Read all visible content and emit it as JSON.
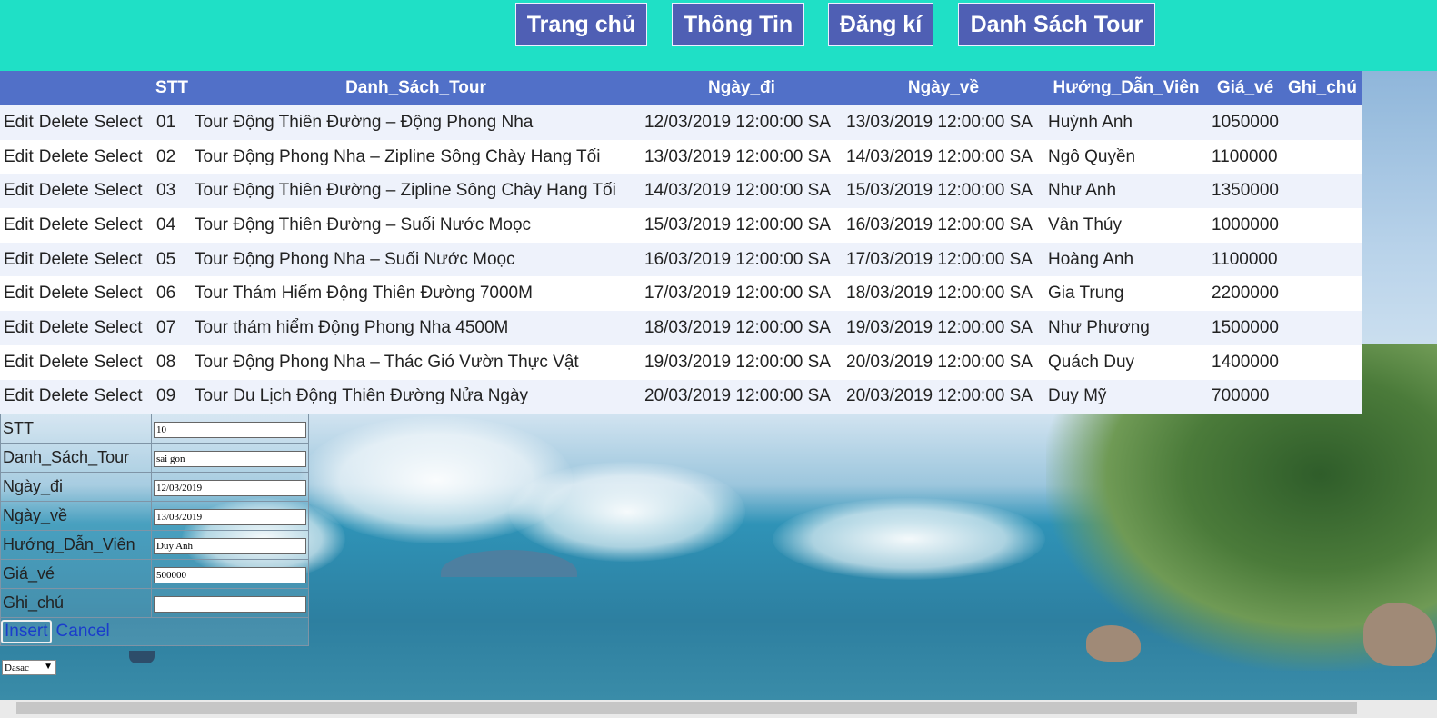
{
  "nav": [
    "Trang chủ",
    "Thông Tin",
    "Đăng kí",
    "Danh Sách Tour"
  ],
  "grid": {
    "headers": [
      "STT",
      "Danh_Sách_Tour",
      "Ngày_đi",
      "Ngày_về",
      "Hướng_Dẫn_Viên",
      "Giá_vé",
      "Ghi_chú"
    ],
    "commands": [
      "Edit",
      "Delete",
      "Select"
    ],
    "rows": [
      [
        "01",
        "Tour Động Thiên Đường – Động Phong Nha",
        "12/03/2019 12:00:00 SA",
        "13/03/2019 12:00:00 SA",
        "Huỳnh Anh",
        "1050000",
        ""
      ],
      [
        "02",
        "Tour Động Phong Nha – Zipline Sông Chày Hang Tối",
        "13/03/2019 12:00:00 SA",
        "14/03/2019 12:00:00 SA",
        "Ngô Quyền",
        "1100000",
        ""
      ],
      [
        "03",
        "Tour Động Thiên Đường – Zipline Sông Chày Hang Tối",
        "14/03/2019 12:00:00 SA",
        "15/03/2019 12:00:00 SA",
        "Như Anh",
        "1350000",
        ""
      ],
      [
        "04",
        "Tour Động Thiên Đường – Suối Nước Moọc",
        "15/03/2019 12:00:00 SA",
        "16/03/2019 12:00:00 SA",
        "Vân Thúy",
        "1000000",
        ""
      ],
      [
        "05",
        "Tour Động Phong Nha – Suối Nước Moọc",
        "16/03/2019 12:00:00 SA",
        "17/03/2019 12:00:00 SA",
        "Hoàng Anh",
        "1100000",
        ""
      ],
      [
        "06",
        "Tour Thám Hiểm Động Thiên Đường 7000M",
        "17/03/2019 12:00:00 SA",
        "18/03/2019 12:00:00 SA",
        "Gia Trung",
        "2200000",
        ""
      ],
      [
        "07",
        "Tour thám hiểm Động Phong Nha 4500M",
        "18/03/2019 12:00:00 SA",
        "19/03/2019 12:00:00 SA",
        "Như Phương",
        "1500000",
        ""
      ],
      [
        "08",
        "Tour Động Phong Nha – Thác Gió Vườn Thực Vật",
        "19/03/2019 12:00:00 SA",
        "20/03/2019 12:00:00 SA",
        "Quách Duy",
        "1400000",
        ""
      ],
      [
        "09",
        "Tour Du Lịch Động Thiên Đường Nửa Ngày",
        "20/03/2019 12:00:00 SA",
        "20/03/2019 12:00:00 SA",
        "Duy Mỹ",
        "700000",
        ""
      ]
    ]
  },
  "form": {
    "fields": [
      {
        "label": "STT",
        "value": "10"
      },
      {
        "label": "Danh_Sách_Tour",
        "value": "sai gon"
      },
      {
        "label": "Ngày_đi",
        "value": "12/03/2019"
      },
      {
        "label": "Ngày_về",
        "value": "13/03/2019"
      },
      {
        "label": "Hướng_Dẫn_Viên",
        "value": "Duy Anh"
      },
      {
        "label": "Giá_vé",
        "value": "500000"
      },
      {
        "label": "Ghi_chú",
        "value": ""
      }
    ],
    "insert_label": "Insert",
    "cancel_label": "Cancel"
  },
  "dropdown": {
    "selected": "Dasac"
  },
  "colors": {
    "topbar": "#1fe0c6",
    "nav_button": "#4f5fb4",
    "grid_header": "#5170c8",
    "link": "#1a3ccc"
  }
}
